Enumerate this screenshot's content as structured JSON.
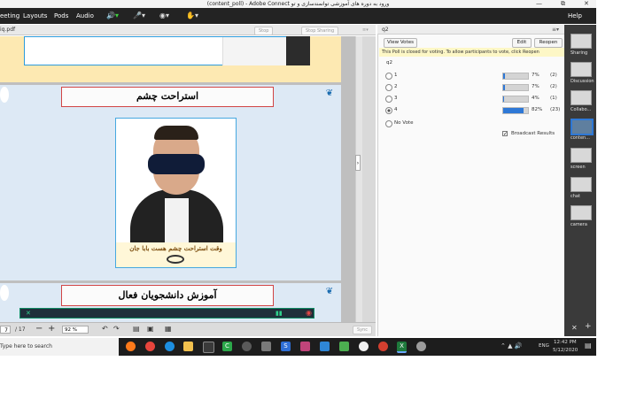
{
  "window": {
    "title": "(content_poll) - Adobe Connect ورود به دوره های آموزشی توانمندسازی و تو",
    "minimize": "—",
    "maximize": "⧉",
    "close": "✕"
  },
  "menu": {
    "items": [
      "eeting",
      "Layouts",
      "Pods",
      "Audio"
    ],
    "help": "Help"
  },
  "share_pod": {
    "filename": "iq.pdf",
    "stop_label": "Stop",
    "stop_sharing_label": "Stop Sharing",
    "slide_rest_title": "استراحت چشم",
    "slide_rest_caption": "وقت استراحت چشم هست بابا جان",
    "slide_active_title": "آموزش دانشجویان فعال",
    "page_current": "7",
    "page_total": "/ 17",
    "zoom": "92 %",
    "sync_label": "Sync"
  },
  "poll": {
    "pod_title": "q2",
    "view_votes_label": "View Votes",
    "edit_label": "Edit",
    "reopen_label": "Reopen",
    "notice": "This Poll is closed for voting. To allow participants to vote, click Reopen",
    "question": "q2",
    "options": [
      {
        "label": "1",
        "percent": "7%",
        "count": "(2)",
        "fill": 0.07,
        "selected": false
      },
      {
        "label": "2",
        "percent": "7%",
        "count": "(2)",
        "fill": 0.07,
        "selected": false
      },
      {
        "label": "3",
        "percent": "4%",
        "count": "(1)",
        "fill": 0.04,
        "selected": false
      },
      {
        "label": "4",
        "percent": "82%",
        "count": "(23)",
        "fill": 0.82,
        "selected": true
      }
    ],
    "no_vote_label": "No Vote",
    "broadcast_label": "Broadcast Results",
    "broadcast_checked": true
  },
  "sidebar": {
    "items": [
      "Sharing",
      "Discussion",
      "Collabo...",
      "conten...",
      "screen",
      "chat",
      "camera"
    ],
    "active_index": 3
  },
  "taskbar": {
    "search_placeholder": "Type here to search",
    "language": "ENG",
    "time": "12:42 PM",
    "date": "5/12/2020"
  },
  "colors": {
    "accent_blue": "#2e78d6",
    "menubar": "#232323",
    "taskbar": "#1d1d1d",
    "slide_title_border": "#d14545"
  }
}
